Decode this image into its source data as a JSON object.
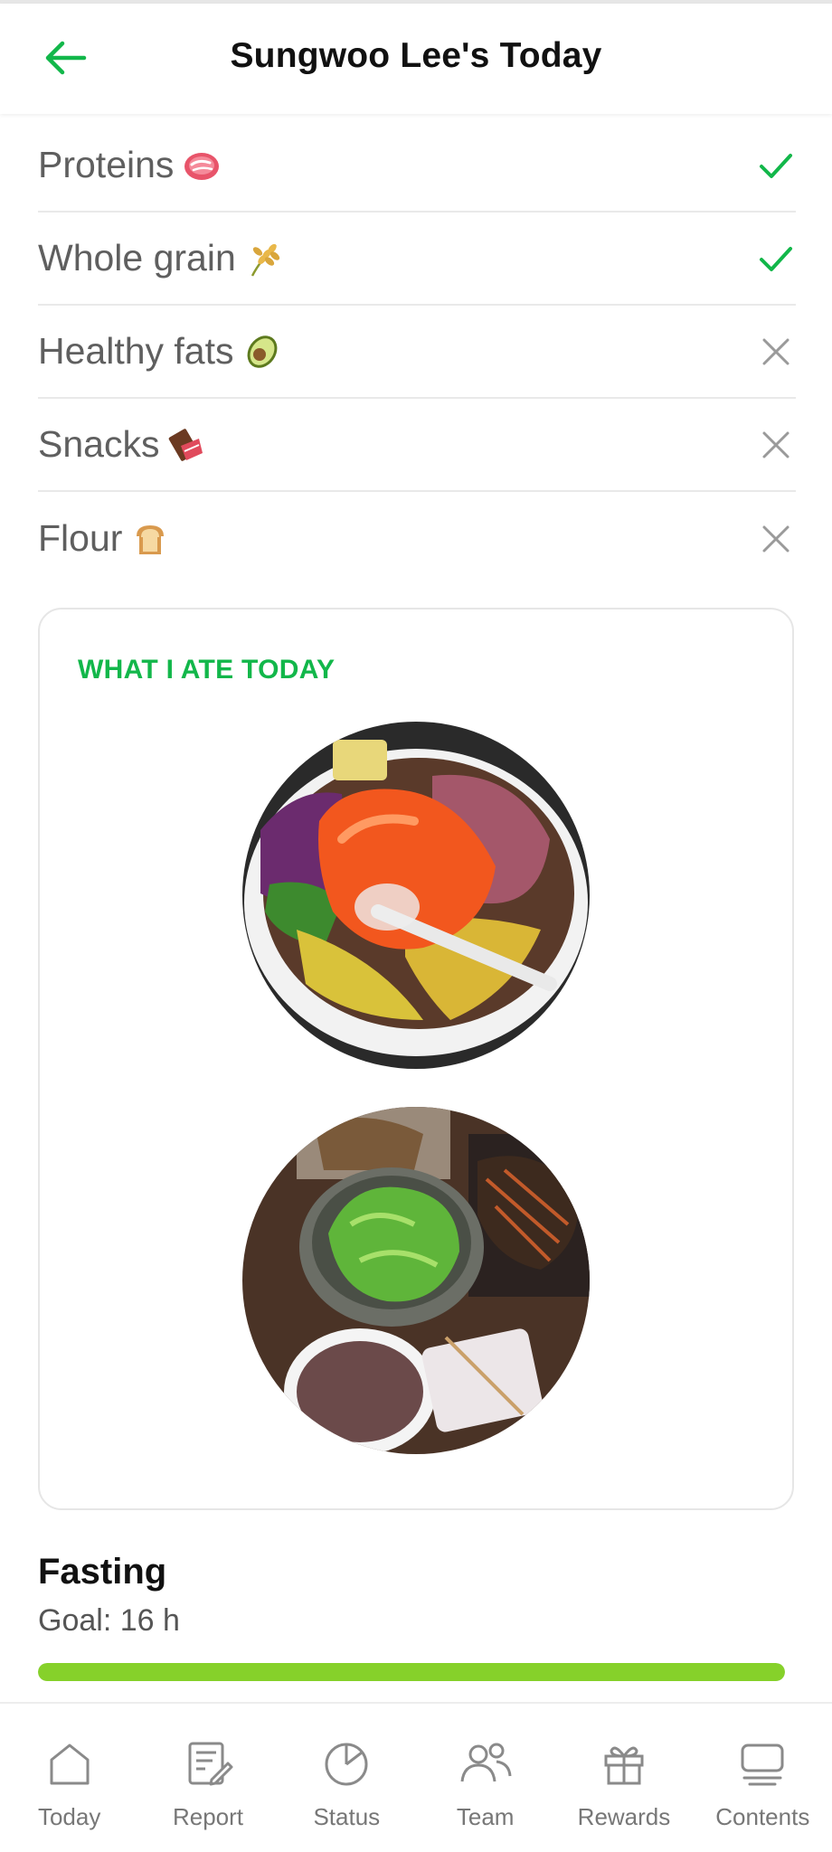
{
  "header": {
    "title": "Sungwoo Lee's Today",
    "back_icon": "arrow-left-icon",
    "accent_color": "#12b74a"
  },
  "checklist": [
    {
      "label": "Proteins",
      "emoji_icon": "meat-icon",
      "status": "check"
    },
    {
      "label": "Whole grain",
      "emoji_icon": "rice-stalk-icon",
      "status": "check"
    },
    {
      "label": "Healthy fats",
      "emoji_icon": "avocado-icon",
      "status": "cross"
    },
    {
      "label": "Snacks",
      "emoji_icon": "chocolate-bar-icon",
      "status": "cross"
    },
    {
      "label": "Flour",
      "emoji_icon": "bread-icon",
      "status": "cross"
    }
  ],
  "ate_today": {
    "title": "WHAT I ATE TODAY",
    "photos": [
      "meal-photo",
      "meal-photo"
    ]
  },
  "fasting": {
    "title": "Fasting",
    "goal": "Goal: 16 h",
    "progress_fraction": 1.0,
    "progress_color": "#86d12a"
  },
  "tabbar": {
    "items": [
      {
        "label": "Today",
        "icon": "home-icon"
      },
      {
        "label": "Report",
        "icon": "report-icon"
      },
      {
        "label": "Status",
        "icon": "pie-chart-icon"
      },
      {
        "label": "Team",
        "icon": "team-icon"
      },
      {
        "label": "Rewards",
        "icon": "gift-icon"
      },
      {
        "label": "Contents",
        "icon": "contents-icon"
      }
    ]
  }
}
